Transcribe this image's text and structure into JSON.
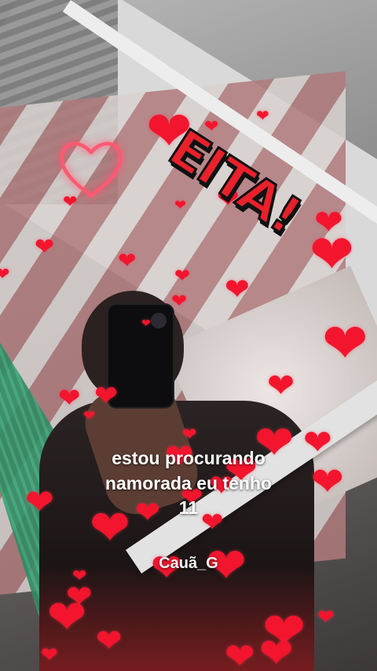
{
  "sticker": {
    "text": "EITA!"
  },
  "caption": {
    "line1": "estou procurando",
    "line2": "namorada eu tenho",
    "line3": "11",
    "handle": "Cauã_G"
  },
  "icons": [
    "heart-icon",
    "neon-heart-icon",
    "phone-camera-icon"
  ],
  "colors": {
    "heart": "#f3152e",
    "neon": "#ff5a72",
    "sticker_fill": "#e8212b",
    "sticker_outline": "#111111"
  }
}
